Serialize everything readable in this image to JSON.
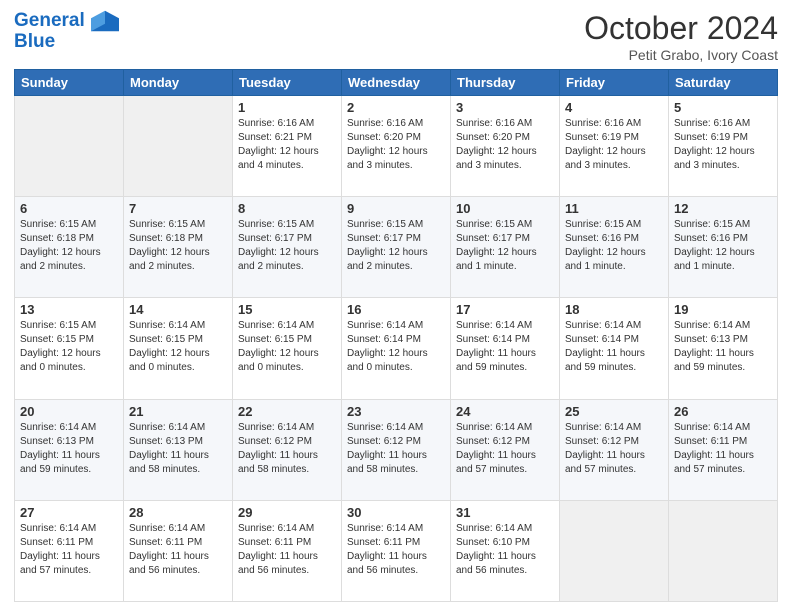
{
  "header": {
    "logo_line1": "General",
    "logo_line2": "Blue",
    "month": "October 2024",
    "location": "Petit Grabo, Ivory Coast"
  },
  "days_of_week": [
    "Sunday",
    "Monday",
    "Tuesday",
    "Wednesday",
    "Thursday",
    "Friday",
    "Saturday"
  ],
  "weeks": [
    [
      {
        "day": "",
        "empty": true
      },
      {
        "day": "",
        "empty": true
      },
      {
        "day": "1",
        "sunrise": "Sunrise: 6:16 AM",
        "sunset": "Sunset: 6:21 PM",
        "daylight": "Daylight: 12 hours and 4 minutes."
      },
      {
        "day": "2",
        "sunrise": "Sunrise: 6:16 AM",
        "sunset": "Sunset: 6:20 PM",
        "daylight": "Daylight: 12 hours and 3 minutes."
      },
      {
        "day": "3",
        "sunrise": "Sunrise: 6:16 AM",
        "sunset": "Sunset: 6:20 PM",
        "daylight": "Daylight: 12 hours and 3 minutes."
      },
      {
        "day": "4",
        "sunrise": "Sunrise: 6:16 AM",
        "sunset": "Sunset: 6:19 PM",
        "daylight": "Daylight: 12 hours and 3 minutes."
      },
      {
        "day": "5",
        "sunrise": "Sunrise: 6:16 AM",
        "sunset": "Sunset: 6:19 PM",
        "daylight": "Daylight: 12 hours and 3 minutes."
      }
    ],
    [
      {
        "day": "6",
        "sunrise": "Sunrise: 6:15 AM",
        "sunset": "Sunset: 6:18 PM",
        "daylight": "Daylight: 12 hours and 2 minutes."
      },
      {
        "day": "7",
        "sunrise": "Sunrise: 6:15 AM",
        "sunset": "Sunset: 6:18 PM",
        "daylight": "Daylight: 12 hours and 2 minutes."
      },
      {
        "day": "8",
        "sunrise": "Sunrise: 6:15 AM",
        "sunset": "Sunset: 6:17 PM",
        "daylight": "Daylight: 12 hours and 2 minutes."
      },
      {
        "day": "9",
        "sunrise": "Sunrise: 6:15 AM",
        "sunset": "Sunset: 6:17 PM",
        "daylight": "Daylight: 12 hours and 2 minutes."
      },
      {
        "day": "10",
        "sunrise": "Sunrise: 6:15 AM",
        "sunset": "Sunset: 6:17 PM",
        "daylight": "Daylight: 12 hours and 1 minute."
      },
      {
        "day": "11",
        "sunrise": "Sunrise: 6:15 AM",
        "sunset": "Sunset: 6:16 PM",
        "daylight": "Daylight: 12 hours and 1 minute."
      },
      {
        "day": "12",
        "sunrise": "Sunrise: 6:15 AM",
        "sunset": "Sunset: 6:16 PM",
        "daylight": "Daylight: 12 hours and 1 minute."
      }
    ],
    [
      {
        "day": "13",
        "sunrise": "Sunrise: 6:15 AM",
        "sunset": "Sunset: 6:15 PM",
        "daylight": "Daylight: 12 hours and 0 minutes."
      },
      {
        "day": "14",
        "sunrise": "Sunrise: 6:14 AM",
        "sunset": "Sunset: 6:15 PM",
        "daylight": "Daylight: 12 hours and 0 minutes."
      },
      {
        "day": "15",
        "sunrise": "Sunrise: 6:14 AM",
        "sunset": "Sunset: 6:15 PM",
        "daylight": "Daylight: 12 hours and 0 minutes."
      },
      {
        "day": "16",
        "sunrise": "Sunrise: 6:14 AM",
        "sunset": "Sunset: 6:14 PM",
        "daylight": "Daylight: 12 hours and 0 minutes."
      },
      {
        "day": "17",
        "sunrise": "Sunrise: 6:14 AM",
        "sunset": "Sunset: 6:14 PM",
        "daylight": "Daylight: 11 hours and 59 minutes."
      },
      {
        "day": "18",
        "sunrise": "Sunrise: 6:14 AM",
        "sunset": "Sunset: 6:14 PM",
        "daylight": "Daylight: 11 hours and 59 minutes."
      },
      {
        "day": "19",
        "sunrise": "Sunrise: 6:14 AM",
        "sunset": "Sunset: 6:13 PM",
        "daylight": "Daylight: 11 hours and 59 minutes."
      }
    ],
    [
      {
        "day": "20",
        "sunrise": "Sunrise: 6:14 AM",
        "sunset": "Sunset: 6:13 PM",
        "daylight": "Daylight: 11 hours and 59 minutes."
      },
      {
        "day": "21",
        "sunrise": "Sunrise: 6:14 AM",
        "sunset": "Sunset: 6:13 PM",
        "daylight": "Daylight: 11 hours and 58 minutes."
      },
      {
        "day": "22",
        "sunrise": "Sunrise: 6:14 AM",
        "sunset": "Sunset: 6:12 PM",
        "daylight": "Daylight: 11 hours and 58 minutes."
      },
      {
        "day": "23",
        "sunrise": "Sunrise: 6:14 AM",
        "sunset": "Sunset: 6:12 PM",
        "daylight": "Daylight: 11 hours and 58 minutes."
      },
      {
        "day": "24",
        "sunrise": "Sunrise: 6:14 AM",
        "sunset": "Sunset: 6:12 PM",
        "daylight": "Daylight: 11 hours and 57 minutes."
      },
      {
        "day": "25",
        "sunrise": "Sunrise: 6:14 AM",
        "sunset": "Sunset: 6:12 PM",
        "daylight": "Daylight: 11 hours and 57 minutes."
      },
      {
        "day": "26",
        "sunrise": "Sunrise: 6:14 AM",
        "sunset": "Sunset: 6:11 PM",
        "daylight": "Daylight: 11 hours and 57 minutes."
      }
    ],
    [
      {
        "day": "27",
        "sunrise": "Sunrise: 6:14 AM",
        "sunset": "Sunset: 6:11 PM",
        "daylight": "Daylight: 11 hours and 57 minutes."
      },
      {
        "day": "28",
        "sunrise": "Sunrise: 6:14 AM",
        "sunset": "Sunset: 6:11 PM",
        "daylight": "Daylight: 11 hours and 56 minutes."
      },
      {
        "day": "29",
        "sunrise": "Sunrise: 6:14 AM",
        "sunset": "Sunset: 6:11 PM",
        "daylight": "Daylight: 11 hours and 56 minutes."
      },
      {
        "day": "30",
        "sunrise": "Sunrise: 6:14 AM",
        "sunset": "Sunset: 6:11 PM",
        "daylight": "Daylight: 11 hours and 56 minutes."
      },
      {
        "day": "31",
        "sunrise": "Sunrise: 6:14 AM",
        "sunset": "Sunset: 6:10 PM",
        "daylight": "Daylight: 11 hours and 56 minutes."
      },
      {
        "day": "",
        "empty": true
      },
      {
        "day": "",
        "empty": true
      }
    ]
  ]
}
